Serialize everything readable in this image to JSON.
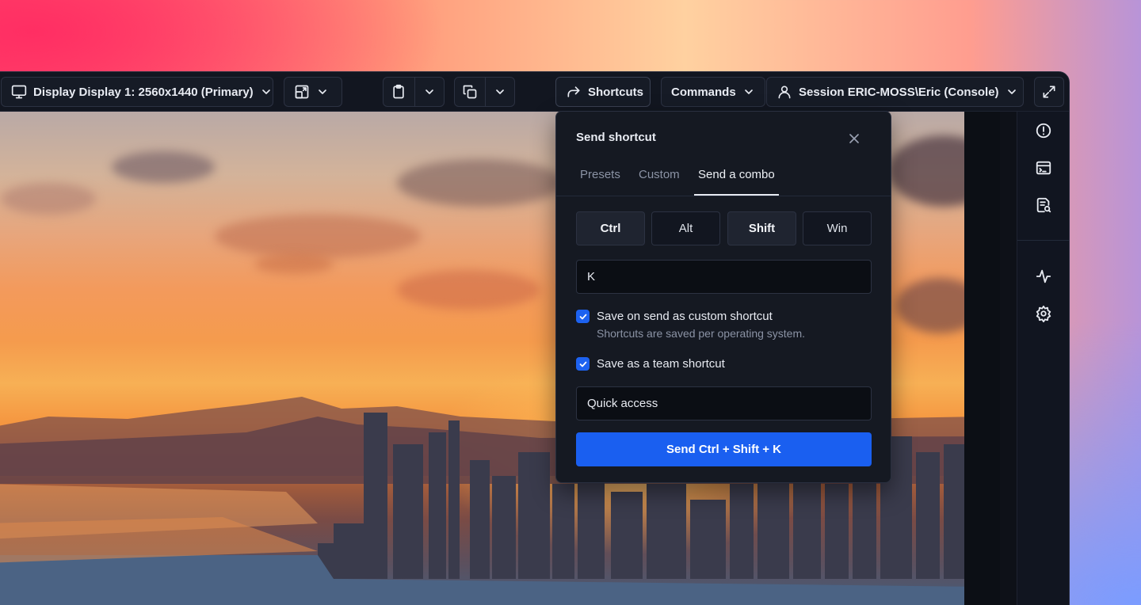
{
  "toolbar": {
    "display_label": "Display Display 1: 2560x1440 (Primary)",
    "shortcuts_label": "Shortcuts",
    "commands_label": "Commands",
    "session_label": "Session ERIC-MOSS\\Eric (Console)"
  },
  "popover": {
    "title": "Send shortcut",
    "tabs": [
      {
        "label": "Presets"
      },
      {
        "label": "Custom"
      },
      {
        "label": "Send a combo",
        "active": true
      }
    ],
    "modifiers": [
      {
        "label": "Ctrl",
        "selected": true
      },
      {
        "label": "Alt",
        "selected": false
      },
      {
        "label": "Shift",
        "selected": true
      },
      {
        "label": "Win",
        "selected": false
      }
    ],
    "key_value": "K",
    "save_custom": {
      "checked": true,
      "label": "Save on send as custom shortcut",
      "hint": "Shortcuts are saved per operating system."
    },
    "save_team": {
      "checked": true,
      "label": "Save as a team shortcut"
    },
    "name_value": "Quick access",
    "send_label": "Send Ctrl + Shift + K"
  },
  "colors": {
    "accent": "#1a5ff0",
    "panel": "#151922",
    "toolbar": "#121620"
  },
  "sidebar": {
    "icons": [
      "alert-circle-icon",
      "terminal-icon",
      "file-search-icon",
      "activity-icon",
      "gear-icon"
    ]
  }
}
